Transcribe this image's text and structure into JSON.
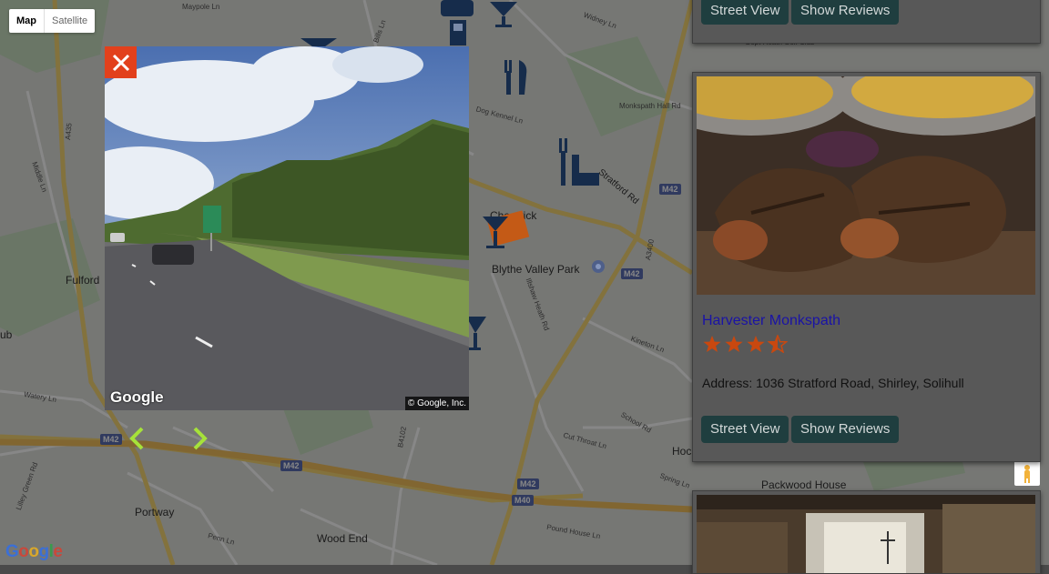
{
  "map": {
    "type_control": {
      "map_label": "Map",
      "satellite_label": "Satellite"
    },
    "places": {
      "fulford": "Fulford",
      "blythe_valley_park": "Blythe Valley Park",
      "hockley": "Hockley",
      "portway": "Portway",
      "wood_end": "Wood End",
      "packwood_house": "Packwood House",
      "ub": "ub",
      "cheswick": "Cheswick"
    },
    "roads": {
      "a435": "A435",
      "m42_1": "M42",
      "m42_2": "M42",
      "m42_3": "M42",
      "m42_4": "M42",
      "m42_5": "M42",
      "m40": "M40",
      "a3400": "A3400",
      "stratford_rd": "Stratford Rd",
      "monkspath_hall_rd": "Monkspath Hall Rd",
      "dog_kennel_ln": "Dog Kennel Ln",
      "widney_ln": "Widney Ln",
      "kineton_ln": "Kineton Ln",
      "cut_throat_ln": "Cut Throat Ln",
      "school_rd": "School Rd",
      "spring_ln": "Spring Ln",
      "penn_ln": "Penn Ln",
      "watery_ln": "Watery Ln",
      "lilley_green_rd": "Lilley Green Rd",
      "middle_ln": "Middle Ln",
      "pound_house_ln": "Pound House Ln",
      "illshaw_heath_rd": "Illshaw Heath Rd",
      "b4102": "B4102",
      "bills_ln": "Bills Ln",
      "maypole_ln": "Maypole Ln",
      "gopt_heath_golf_club": "Gopt Heath Golf Club"
    },
    "google_logo": "Google"
  },
  "street_view": {
    "google_label": "Google",
    "copyright": "© Google, Inc."
  },
  "cards": [
    {
      "street_view_label": "Street View",
      "reviews_label": "Show Reviews"
    },
    {
      "title": "Harvester Monkspath",
      "rating": 3.5,
      "address": "Address: 1036 Stratford Road, Shirley, Solihull",
      "street_view_label": "Street View",
      "reviews_label": "Show Reviews"
    },
    {
      "title": ""
    }
  ],
  "colors": {
    "close_button": "#e2401c",
    "nav_arrows": "#a6e23a",
    "button_bg": "#1f3e3f",
    "link": "#1a13a6",
    "star": "#c9480f",
    "poi": "#162c4b"
  }
}
